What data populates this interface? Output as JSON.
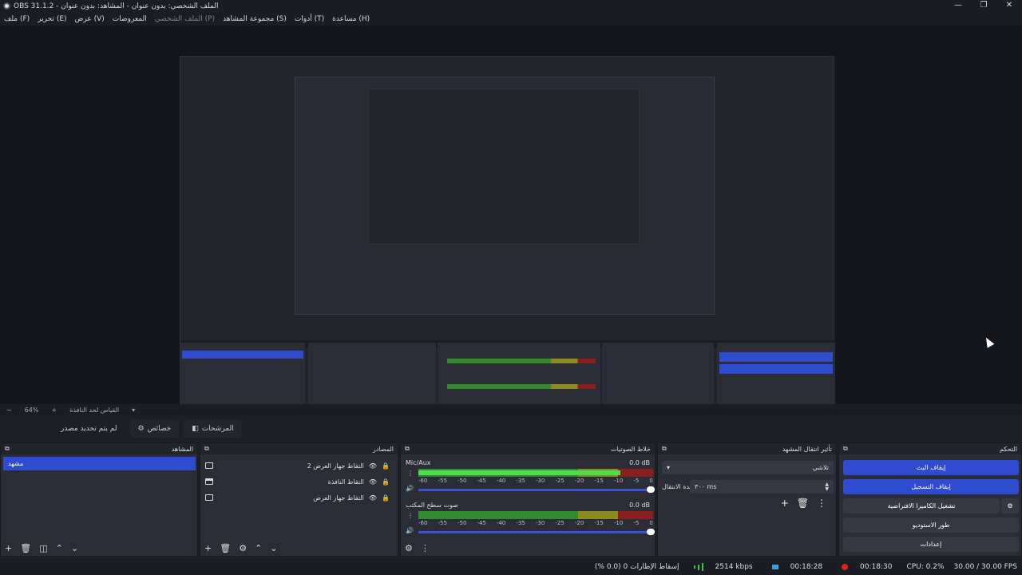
{
  "window": {
    "title": "OBS 31.1.2 - الملف الشخصي: بدون عنوان - المشاهد: بدون عنوان",
    "controls": [
      "—",
      "❐",
      "✕"
    ]
  },
  "menu": [
    {
      "label": "ملف (F)",
      "disabled": false
    },
    {
      "label": "تحرير (E)",
      "disabled": false
    },
    {
      "label": "عرض (V)",
      "disabled": false
    },
    {
      "label": "المعروضات",
      "disabled": false
    },
    {
      "label": "الملف الشخصي (P)",
      "disabled": true
    },
    {
      "label": "مجموعة المشاهد (S)",
      "disabled": false
    },
    {
      "label": "أدوات (T)",
      "disabled": false
    },
    {
      "label": "مساعدة (H)",
      "disabled": false
    }
  ],
  "zoom": {
    "minus": "−",
    "value": "64%",
    "plus": "+",
    "mode": "القياس لحد النافذة"
  },
  "toolbar2": {
    "filters": "المرشحات",
    "properties": "خصائص",
    "no_source": "لم يتم تحديد مصدر"
  },
  "scenes": {
    "header": "المشاهد",
    "items": [
      "مشهد"
    ]
  },
  "sources": {
    "header": "المصادر",
    "items": [
      {
        "label": "التقاط جهاز العرض 2"
      },
      {
        "label": "التقاط النافذة"
      },
      {
        "label": "التقاط جهاز العرض"
      }
    ]
  },
  "mixer": {
    "header": "خلاط الصوتيات",
    "ticks": [
      "-60",
      "-55",
      "-50",
      "-45",
      "-40",
      "-35",
      "-30",
      "-25",
      "-20",
      "-15",
      "-10",
      "-5",
      "0"
    ],
    "channels": [
      {
        "name": "Mic/Aux",
        "db": "0.0 dB",
        "level": 0.86
      },
      {
        "name": "صوت سطح المكتب",
        "db": "0.0 dB",
        "level": 0.0
      }
    ]
  },
  "transitions": {
    "header": "تأثير انتقال المشهد",
    "type": "تلاشي",
    "duration_label": "مدة الانتقال",
    "duration_value": "٣٠٠ ms"
  },
  "controls": {
    "header": "التحكم",
    "buttons": [
      {
        "label": "إيقاف البث",
        "active": true
      },
      {
        "label": "إيقاف التسجيل",
        "active": true
      },
      {
        "label": "تشغيل الكاميرا الافتراضية",
        "active": false
      },
      {
        "label": "طور الاستوديو",
        "active": false
      },
      {
        "label": "إعدادات",
        "active": false
      }
    ]
  },
  "status": {
    "dropped": "إسقاط الإطارات 0 (0.0 %)",
    "bitrate": "2514 kbps",
    "stream_time": "00:18:28",
    "rec_time": "00:18:30",
    "cpu": "CPU: 0.2%",
    "fps": "30.00 / 30.00 FPS"
  }
}
